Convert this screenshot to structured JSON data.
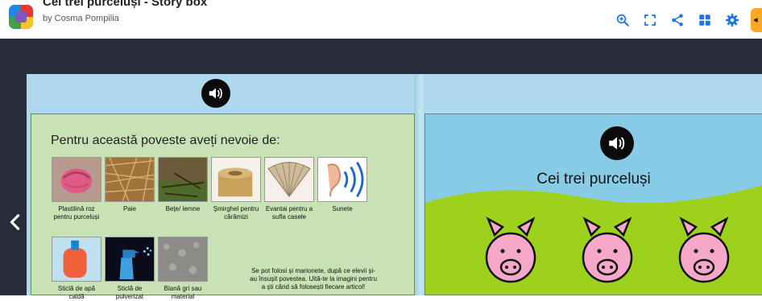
{
  "header": {
    "title": "Cei trei purceluși - Story box",
    "author": "by Cosma Pompilia",
    "icons": [
      "zoom-in-icon",
      "fullscreen-icon",
      "share-icon",
      "grid-icon",
      "gear-icon",
      "audio-icon"
    ]
  },
  "left_page": {
    "heading": "Pentru această poveste aveți nevoie de:",
    "items_row1": [
      {
        "label": "Plastilină roz pentru purceluși",
        "thumb": "pink-clay"
      },
      {
        "label": "Paie",
        "thumb": "straw"
      },
      {
        "label": "Bețe/ lemne",
        "thumb": "sticks"
      },
      {
        "label": "Șmirghel pentru cărămizi",
        "thumb": "sandpaper"
      },
      {
        "label": "Evantai pentru a sufla casele",
        "thumb": "fan"
      },
      {
        "label": "Sunete",
        "thumb": "ear-sound"
      }
    ],
    "items_row2": [
      {
        "label": "Sticlă de apă caldă",
        "thumb": "hot-water-bottle"
      },
      {
        "label": "Sticlă de pulverizat",
        "thumb": "spray-bottle"
      },
      {
        "label": "Blană gri sau material",
        "thumb": "grey-fur"
      }
    ],
    "note": "Se pot folosi și marionete, după ce elevii și-au însușit povestea. Uită-te la imagini pentru a ști când să folosești fiecare articol!"
  },
  "right_page": {
    "title": "Cei trei purceluși"
  },
  "colors": {
    "stage": "#272b3a",
    "page": "#aed8ee",
    "card": "#c8e2b6",
    "accent": "#1a73e8",
    "grass": "#9ed11b",
    "pig": "#f7a8c8"
  }
}
